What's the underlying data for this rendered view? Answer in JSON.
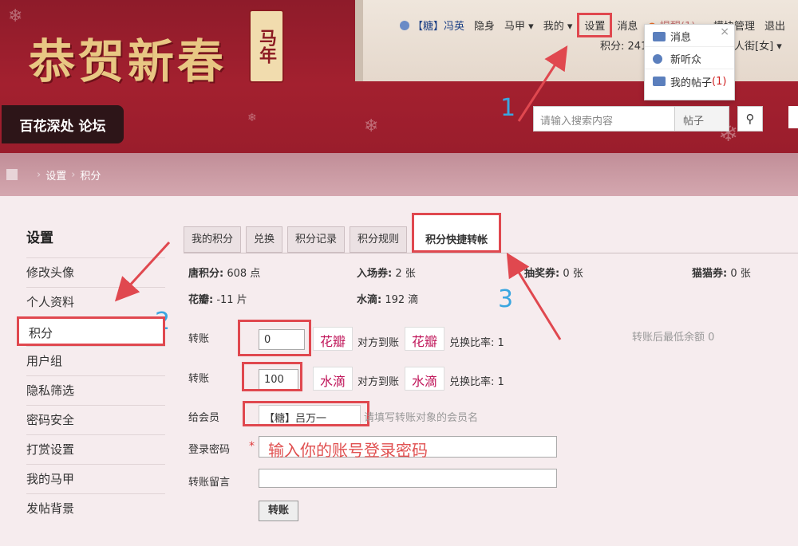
{
  "banner": {
    "title": "恭贺新春",
    "seal": "马年"
  },
  "topnav": {
    "user": "【糖】冯英",
    "items": [
      "隐身",
      "马甲 ▾",
      "我的 ▾",
      "设置",
      "消息",
      "提醒(1) ▾",
      "模块管理",
      "退出"
    ]
  },
  "score_row": {
    "left": "积分: 241",
    "right": "人街[女] ▾"
  },
  "dropdown": {
    "close": "×",
    "items": [
      {
        "label": "消息",
        "icon": "mail-icon"
      },
      {
        "label": "新听众",
        "icon": "person-icon"
      },
      {
        "label": "我的帖子",
        "count": "(1)",
        "icon": "post-icon"
      }
    ]
  },
  "forum_name": "百花深处 论坛",
  "search": {
    "placeholder": "请输入搜索内容",
    "scope": "帖子"
  },
  "breadcrumb": [
    "设置",
    "积分"
  ],
  "annotations": {
    "n1": "1",
    "n2": "2",
    "n3": "3"
  },
  "sidebar": {
    "title": "设置",
    "items": [
      "修改头像",
      "个人资料",
      "积分",
      "用户组",
      "隐私筛选",
      "密码安全",
      "打赏设置",
      "我的马甲",
      "发帖背景"
    ],
    "active_index": 2
  },
  "tabs": [
    "我的积分",
    "兑换",
    "积分记录",
    "积分规则",
    "积分快捷转帐"
  ],
  "stats": {
    "tang_label": "唐积分:",
    "tang_value": "608 点",
    "ticket_label": "入场券:",
    "ticket_value": "2 张",
    "lottery_label": "抽奖券:",
    "lottery_value": "0 张",
    "cat_label": "猫猫券:",
    "cat_value": "0 张",
    "petal_label": "花瓣:",
    "petal_value": "-11 片",
    "water_label": "水滴:",
    "water_value": "192 滴"
  },
  "form": {
    "transfer_label": "转账",
    "row1_value": "0",
    "row1_unit": "花瓣",
    "to_account": "对方到账",
    "row1_unit2": "花瓣",
    "ratio": "兑换比率: 1",
    "min_balance": "转账后最低余额 0",
    "row2_value": "100",
    "row2_unit": "水滴",
    "row2_unit2": "水滴",
    "member_label": "给会员",
    "member_value": "【糖】吕万一",
    "member_hint": "请填写转账对象的会员名",
    "password_label": "登录密码",
    "password_star": "*",
    "password_hint": "输入你的账号登录密码",
    "message_label": "转账留言",
    "submit": "转账"
  }
}
